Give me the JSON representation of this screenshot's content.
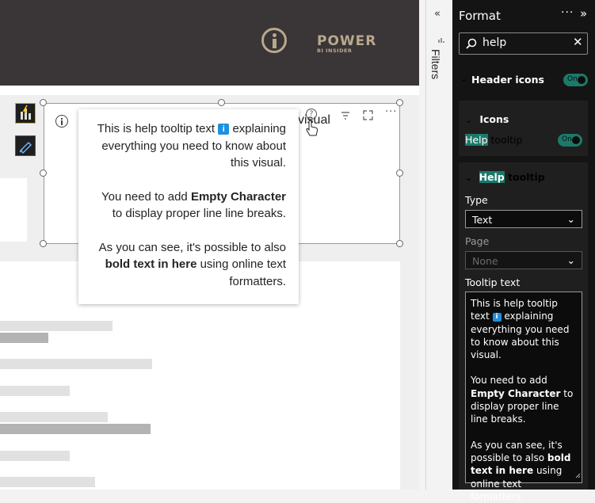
{
  "logo": {
    "brand": "POWER",
    "sub": "BI INSIDER"
  },
  "visual": {
    "title_fragment": "visual",
    "header_icons": [
      "info-icon",
      "help-icon",
      "filter-icon",
      "focus-mode-icon",
      "more-options-icon"
    ]
  },
  "tooltip": {
    "line1a": "This is help tooltip text",
    "info_glyph": "i",
    "line1b": "explaining everything you need to know about this visual.",
    "p2a": "You need to add",
    "p2bold": "Empty Character",
    "p2b": "to display proper line line breaks.",
    "p3a": "As you can see, it's possible to also",
    "p3bold": "bold text in here",
    "p3b": "using online text formatters."
  },
  "filters": {
    "label": "Filters"
  },
  "format_pane": {
    "title": "Format",
    "search_value": "help",
    "header_icons_label": "Header icons",
    "header_icons_toggle": "On",
    "icons_label": "Icons",
    "help_tooltip_row": {
      "highlight": "Help",
      "rest": "tooltip",
      "toggle": "On"
    },
    "help_tooltip_section": {
      "highlight": "Help",
      "rest": "tooltip"
    },
    "type_label": "Type",
    "type_value": "Text",
    "page_label": "Page",
    "page_placeholder": "None",
    "tooltip_text_label": "Tooltip text",
    "tooltip_text": {
      "line1a": "This is help tooltip text",
      "info_glyph": "i",
      "line1b": "explaining everything you need to know about this visual.",
      "p2a": "You need to add",
      "p2bold": "Empty Character",
      "p2b": "to display proper line line breaks.",
      "p3a": "As you can see, it's possible to also",
      "p3bold": "bold text in here",
      "p3b": "using online text formatters."
    }
  },
  "colors": {
    "accent": "#1b7a6a",
    "pane_bg": "#141414",
    "topbar": "#3a3536",
    "logo": "#b8a98e",
    "info_chip": "#1e90e0"
  }
}
